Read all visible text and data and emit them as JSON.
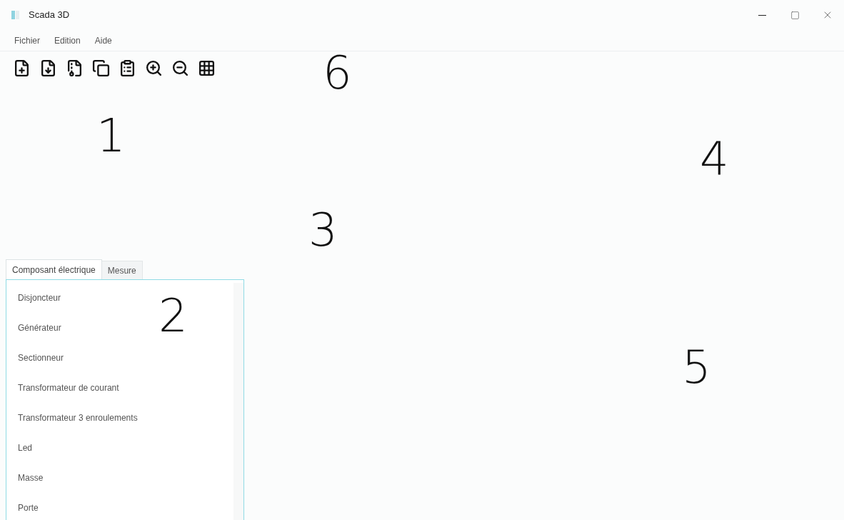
{
  "window": {
    "title": "Scada 3D"
  },
  "menu": [
    "Fichier",
    "Edition",
    "Aide"
  ],
  "toolbar": [
    {
      "kind": "new"
    },
    {
      "kind": "save"
    },
    {
      "kind": "export"
    },
    {
      "kind": "copy"
    },
    {
      "kind": "paste"
    },
    {
      "kind": "zoom_in"
    },
    {
      "kind": "zoom_out"
    },
    {
      "kind": "grid"
    }
  ],
  "tabs": [
    {
      "label": "Composant électrique",
      "selected": true
    },
    {
      "label": "Mesure",
      "selected": false
    }
  ],
  "components": [
    "Disjoncteur",
    "Générateur",
    "Sectionneur",
    "Transformateur de courant",
    "Transformateur 3 enroulements",
    "Led",
    "Masse",
    "Porte"
  ],
  "annotations": [
    "6",
    "1",
    "4",
    "3",
    "2",
    "5"
  ]
}
